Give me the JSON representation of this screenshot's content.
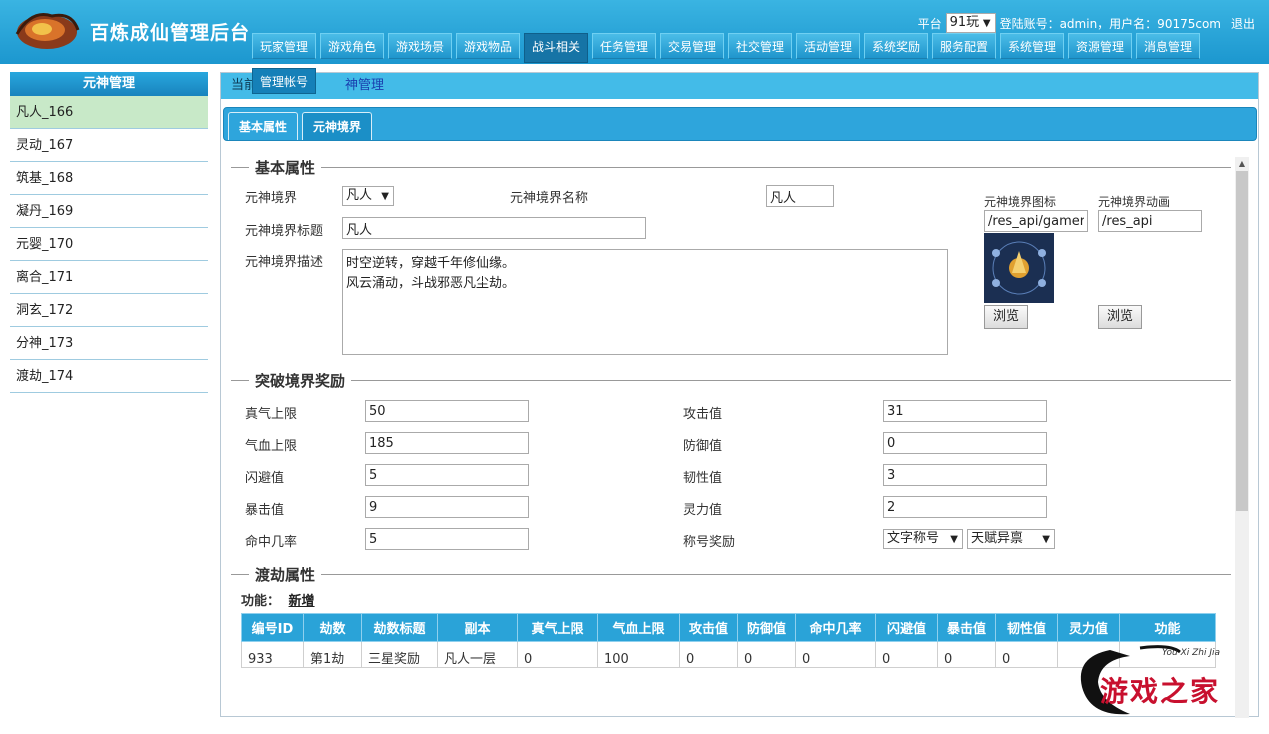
{
  "app": {
    "title": "百炼成仙管理后台"
  },
  "topbar": {
    "platform_label": "平台",
    "platform_value": "91玩",
    "account_text": "登陆账号：admin，用户名：90175com",
    "logout": "退出"
  },
  "nav": {
    "items": [
      "玩家管理",
      "游戏角色",
      "游戏场景",
      "游戏物品",
      "战斗相关",
      "任务管理",
      "交易管理",
      "社交管理",
      "活动管理",
      "系统奖励",
      "服务配置",
      "系统管理",
      "资源管理",
      "消息管理"
    ],
    "active_index": 4,
    "dropdown_item": "管理帐号"
  },
  "sidebar": {
    "title": "元神管理",
    "items": [
      "凡人_166",
      "灵动_167",
      "筑基_168",
      "凝丹_169",
      "元婴_170",
      "离合_171",
      "洞玄_172",
      "分神_173",
      "渡劫_174"
    ],
    "active_index": 0
  },
  "breadcrumb": {
    "prefix": "当前",
    "link": "神管理"
  },
  "tabs": {
    "items": [
      "基本属性",
      "元神境界"
    ],
    "active_index": 1
  },
  "basic": {
    "heading": "基本属性",
    "realm_label": "元神境界",
    "realm_value": "凡人",
    "realm_name_label": "元神境界名称",
    "realm_name_value": "凡人",
    "realm_title_label": "元神境界标题",
    "realm_title_value": "凡人",
    "realm_desc_label": "元神境界描述",
    "realm_desc_value": "时空逆转，穿越千年修仙缘。\n风云涌动，斗战邪恶凡尘劫。",
    "icon_label": "元神境界图标",
    "icon_value": "/res_api/gamere",
    "anim_label": "元神境界动画",
    "anim_value": "/res_api",
    "browse_label": "浏览"
  },
  "breakthrough": {
    "heading": "突破境界奖励",
    "fields_left": [
      {
        "label": "真气上限",
        "value": "50"
      },
      {
        "label": "气血上限",
        "value": "185"
      },
      {
        "label": "闪避值",
        "value": "5"
      },
      {
        "label": "暴击值",
        "value": "9"
      },
      {
        "label": "命中几率",
        "value": "5"
      }
    ],
    "fields_right": [
      {
        "label": "攻击值",
        "value": "31"
      },
      {
        "label": "防御值",
        "value": "0"
      },
      {
        "label": "韧性值",
        "value": "3"
      },
      {
        "label": "灵力值",
        "value": "2"
      }
    ],
    "title_reward_label": "称号奖励",
    "title_type_value": "文字称号",
    "title_name_value": "天赋异禀"
  },
  "tribulation": {
    "heading": "渡劫属性",
    "function_label": "功能：",
    "add_link": "新增",
    "columns": [
      "编号ID",
      "劫数",
      "劫数标题",
      "副本",
      "真气上限",
      "气血上限",
      "攻击值",
      "防御值",
      "命中几率",
      "闪避值",
      "暴击值",
      "韧性值",
      "灵力值",
      "功能"
    ],
    "rows": [
      [
        "933",
        "第1劫",
        "三星奖励",
        "凡人一层",
        "0",
        "100",
        "0",
        "0",
        "0",
        "0",
        "0",
        "0",
        "",
        ""
      ]
    ]
  },
  "watermark": {
    "text": "游戏之家",
    "subtext": "You Xi Zhi Jia"
  }
}
